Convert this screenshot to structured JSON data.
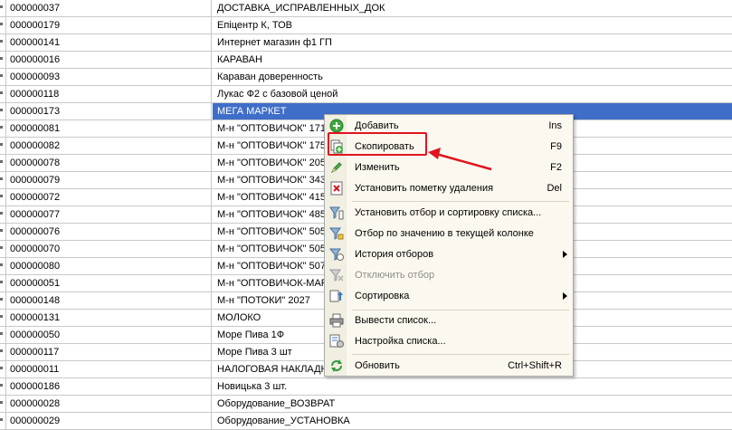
{
  "rows": [
    {
      "code": "000000037",
      "name": "ДОСТАВКА_ИСПРАВЛЕННЫХ_ДОК"
    },
    {
      "code": "000000179",
      "name": "Епіцентр К, ТОВ"
    },
    {
      "code": "000000141",
      "name": "Интернет магазин ф1 ГП"
    },
    {
      "code": "000000016",
      "name": "КАРАВАН"
    },
    {
      "code": "000000093",
      "name": "Караван доверенность"
    },
    {
      "code": "000000118",
      "name": "Лукас Ф2 с базовой ценой"
    },
    {
      "code": "000000173",
      "name": "МЕГА МАРКЕТ"
    },
    {
      "code": "000000081",
      "name": "М-н \"ОПТОВИЧОК\" 171"
    },
    {
      "code": "000000082",
      "name": "М-н \"ОПТОВИЧОК\" 175"
    },
    {
      "code": "000000078",
      "name": "М-н \"ОПТОВИЧОК\" 205"
    },
    {
      "code": "000000079",
      "name": "М-н \"ОПТОВИЧОК\" 343"
    },
    {
      "code": "000000072",
      "name": "М-н \"ОПТОВИЧОК\" 415"
    },
    {
      "code": "000000077",
      "name": "М-н \"ОПТОВИЧОК\" 485"
    },
    {
      "code": "000000076",
      "name": "М-н \"ОПТОВИЧОК\" 505"
    },
    {
      "code": "000000070",
      "name": "М-н \"ОПТОВИЧОК\" 505"
    },
    {
      "code": "000000080",
      "name": "М-н \"ОПТОВИЧОК\" 507"
    },
    {
      "code": "000000051",
      "name": "М-н \"ОПТОВИЧОК-МАР"
    },
    {
      "code": "000000148",
      "name": "М-н \"ПОТОКИ\" 2027"
    },
    {
      "code": "000000131",
      "name": "МОЛОКО"
    },
    {
      "code": "000000050",
      "name": "Море Пива 1Ф"
    },
    {
      "code": "000000117",
      "name": "Море Пива 3 шт"
    },
    {
      "code": "000000011",
      "name": "НАЛОГОВАЯ НАКЛАДН"
    },
    {
      "code": "000000186",
      "name": "Новицька 3 шт."
    },
    {
      "code": "000000028",
      "name": "Оборудование_ВОЗВРАТ"
    },
    {
      "code": "000000029",
      "name": "Оборудование_УСТАНОВКА"
    }
  ],
  "selected_row_index": 6,
  "context_menu": {
    "items": [
      {
        "label": "Добавить",
        "shortcut": "Ins",
        "icon": "add-icon"
      },
      {
        "label": "Скопировать",
        "shortcut": "F9",
        "icon": "copy-icon"
      },
      {
        "label": "Изменить",
        "shortcut": "F2",
        "icon": "edit-pencil-icon"
      },
      {
        "label": "Установить пометку удаления",
        "shortcut": "Del",
        "icon": "delete-mark-icon"
      },
      {
        "label": "Установить отбор и сортировку списка...",
        "shortcut": "",
        "icon": "filter-sort-icon"
      },
      {
        "label": "Отбор по значению в текущей колонке",
        "shortcut": "",
        "icon": "filter-value-icon"
      },
      {
        "label": "История отборов",
        "shortcut": "",
        "icon": "filter-history-icon"
      },
      {
        "label": "Отключить отбор",
        "shortcut": "",
        "icon": "filter-off-icon"
      },
      {
        "label": "Сортировка",
        "shortcut": "",
        "icon": "sort-icon"
      },
      {
        "label": "Вывести список...",
        "shortcut": "",
        "icon": "print-list-icon"
      },
      {
        "label": "Настройка списка...",
        "shortcut": "",
        "icon": "list-settings-icon"
      },
      {
        "label": "Обновить",
        "shortcut": "Ctrl+Shift+R",
        "icon": "refresh-icon"
      }
    ]
  },
  "colors": {
    "selection": "#3f6ec8",
    "highlight_box": "#e0141e",
    "menu_background": "#fbf9ef"
  }
}
